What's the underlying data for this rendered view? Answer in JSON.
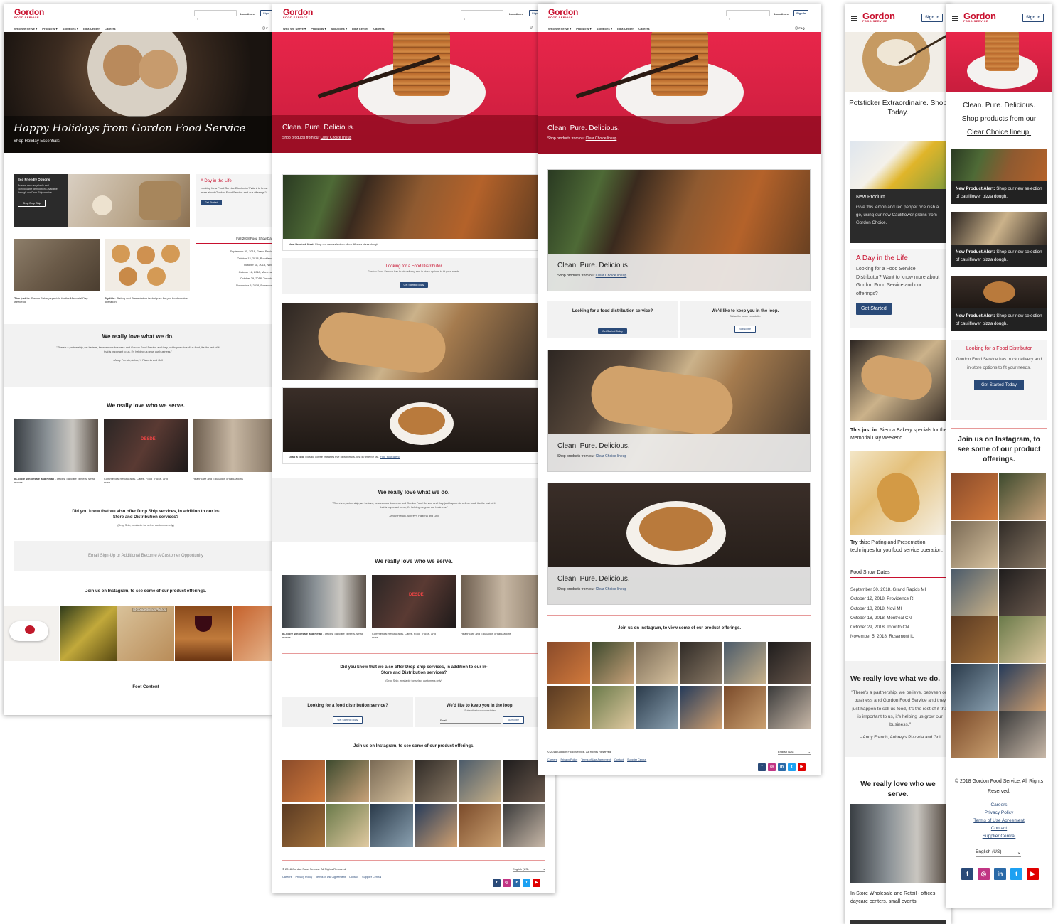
{
  "brand": {
    "logo": "Gordon",
    "logo_sub": "FOOD SERVICE",
    "accent": "#c8102e",
    "navy": "#2a4a78"
  },
  "header": {
    "locations": "Locations",
    "sign_in_short": "Sign I",
    "sign_in": "Sign In",
    "sign_in_cut": "Sign",
    "faq": "FAQ",
    "faq_cut": "F",
    "nav": [
      "Who We Serve",
      "Products",
      "Solutions",
      "Idea Center",
      "Careers"
    ]
  },
  "p1": {
    "hero_title": "Happy Holidays from Gordon Food Service",
    "hero_sub": "Shop Holiday Essentials.",
    "eco_title": "Eco Friendly Options",
    "eco_text": "Browse new recyclable and compostable dish options available through our Drop Ship service.",
    "eco_btn": "Shop Drop Ship",
    "day_title": "A Day in the Life",
    "day_text": "Looking for a Food Service Distributor? Want to know more about Gordon Food Service and our offerings?",
    "day_btn": "Get Started",
    "show_title": "Fall 2018 Food Show Dat",
    "show_dates": [
      "September 30, 2018, Grand Rapid",
      "October 12, 2018, Providenc",
      "October 18, 2018, Novi",
      "October 18, 2018, Montreal",
      "October 29, 2018, Toronto",
      "November 5, 2018, Rosemon"
    ],
    "justin_label": "This just in:",
    "justin_text": "Sienna Bakery specials for the Memorial Day weekend.",
    "trythis_label": "Try this:",
    "trythis_text": "Plating and Presentation techniques for you food service operation.",
    "love_title": "We really love what we do.",
    "quote": "\"There's a partnership, we believe, between our business and Gordon Food Service and they just happen to sell us food, it's the rest of it that is important to us, it's helping us grow our business.\"",
    "quote_author": "- Andy French, Aubrey's Pizzeria and Grill",
    "serve_title": "We really love who we serve.",
    "serve_1_label": "In-Store Wholesale and Retail",
    "serve_1_text": " - offices, daycare centers, small events",
    "serve_2": "Commercial Restaurants, Cafes, Food Trucks, and more...",
    "serve_3": "Healthcare and Education organizations",
    "dropship_q": "Did you know that we also offer Drop Ship services, in addition to our In-Store and Distribution services?",
    "dropship_note": "(Drop Ship, available for select customers only)",
    "email_signup": "Email Sign-Up or Additional Become A Customer Opportunity",
    "insta_title": "Join us on Instagram, to see some of our product offerings.",
    "insta_handle": "@GoodeBumpsPhotos",
    "footer": "Foot Content"
  },
  "p2": {
    "hero_title": "Clean. Pure. Delicious.",
    "hero_sub": "Shop products from our ",
    "hero_link": "Clear Choice lineup",
    "alert_label": "New Product Alert:",
    "alert_text": "Shop our new selection of cauliflower pizza dough.",
    "dist_title": "Looking for a Food Distributor",
    "dist_text": "Gordon Food Service has truck delivery and in-store options to fit your needs.",
    "dist_btn": "Get Started Today",
    "cup_label": "Grab a cup:",
    "cup_text": "Mosaic coffee releases five new blends, just in time for fall. ",
    "cup_link": "Find Your Blend",
    "love_title": "We really love what we do.",
    "quote": "\"There's a partnership, we believe, between our business and Gordon Food Service and they just happen to sell us food, it's the rest of it that is important to us, it's helping us grow our business.\"",
    "quote_author": "- Andy French, Aubrey's Pizzeria and Grill",
    "serve_title": "We really love who we serve.",
    "serve_1_label": "In-Store Wholesale and Retail",
    "serve_1_text": " - offices, daycare centers, small events",
    "serve_2": "Commercial Restaurants, Cafes, Food Trucks, and more.",
    "serve_3": "Healthcare and Education organizations",
    "dropship_q": "Did you know that we also offer Drop Ship services, in addition to our In-Store and Distribution services?",
    "dropship_note": "(Drop Ship, available for select customers only)",
    "look_title": "Looking for a food distribution service?",
    "look_btn": "Get Started Today",
    "loop_title": "We'd like to keep you in the loop.",
    "loop_sub": "Subscribe to our newsletter",
    "email_label": "Email",
    "sub_btn": "Subscribe",
    "insta_title": "Join us on Instagram, to see some of our product offerings.",
    "copyright": "© 2018 Gordon Food Service. All Rights Reserved.",
    "lang": "English (US)",
    "links": [
      "Careers",
      "Privacy Policy",
      "Terms of Use Agreement",
      "Contact",
      "Supplier Central"
    ]
  },
  "p3": {
    "hero_title": "Clean. Pure. Delicious.",
    "hero_sub": "Shop products from our ",
    "hero_link": "Clear Choice lineup",
    "look_title": "Looking for a food distribution service?",
    "look_btn": "Get Started Today",
    "loop_title": "We'd like to keep you in the loop.",
    "loop_sub": "Subscribe to our newsletter",
    "sub_btn": "Subscribe",
    "insta_title": "Join us on Instagram, to view some of our product offerings.",
    "copyright": "© 2018 Gordon Food Service. All Rights Reserved.",
    "lang": "English (US)",
    "links": [
      "Careers",
      "Privacy Policy",
      "Terms of Use Agreement",
      "Contact",
      "Supplier Central"
    ]
  },
  "p4": {
    "potsticker": "Potsticker Extraordinaire. Shop Today.",
    "newprod_title": "New Product",
    "newprod_text": "Give this lemon and red pepper rice dish a go, using our new Cauliflower grains from Gordon Choice.",
    "day_title": "A Day in the Life",
    "day_text": "Looking for a Food Service Distributor? Want to know more about Gordon Food Service and our offerings?",
    "day_btn": "Get Started",
    "justin_label": "This just in:",
    "justin_text": "Sienna Bakery specials for the Memorial Day weekend.",
    "trythis_label": "Try this:",
    "trythis_text": "Plating and Presentation techniques for you food service operation.",
    "show_title": "Food Show Dates",
    "show_dates": [
      "September 30, 2018, Grand Rapids MI",
      "October 12, 2018, Providence RI",
      "October 18, 2018, Novi MI",
      "October 18, 2018, Montreal CN",
      "October 29, 2018, Toronto CN",
      "November 5, 2018, Rosemont IL"
    ],
    "love_title": "We really love what we do.",
    "quote": "\"There's a partnership, we believe, between our business and Gordon Food Service and they just happen to sell us food, it's the rest of it that is important to us, it's helping us grow our business.\"",
    "quote_author": "- Andy French, Aubrey's Pizzeria and Grill",
    "serve_title": "We really love who we serve.",
    "serve_1": "In-Store Wholesale and Retail - offices, daycare centers, small events"
  },
  "p5": {
    "hero_title": "Clean. Pure. Delicious.",
    "hero_sub": "Shop products from our ",
    "hero_link": "Clear Choice lineup.",
    "alert_label": "New Product Alert:",
    "alert_text": "Shop our new selection of cauliflower pizza dough.",
    "dist_title": "Looking for a Food Distributor",
    "dist_text": "Gordon Food Service has truck delivery and in-store options to fit your needs.",
    "dist_btn": "Get Started Today",
    "insta_title": "Join us on Instagram, to see some of our product offerings.",
    "copyright": "© 2018 Gordon Food Service. All Rights Reserved.",
    "lang": "English (US)",
    "links": [
      "Careers",
      "Privacy Policy",
      "Terms of Use Agreement",
      "Contact",
      "Supplier Central"
    ]
  },
  "social": [
    {
      "name": "facebook",
      "glyph": "f",
      "color": "#2a4a78"
    },
    {
      "name": "instagram",
      "glyph": "◎",
      "color": "#c13584"
    },
    {
      "name": "linkedin",
      "glyph": "in",
      "color": "#2a6aa8"
    },
    {
      "name": "twitter",
      "glyph": "t",
      "color": "#1da1f2"
    },
    {
      "name": "youtube",
      "glyph": "▶",
      "color": "#e00000"
    }
  ]
}
